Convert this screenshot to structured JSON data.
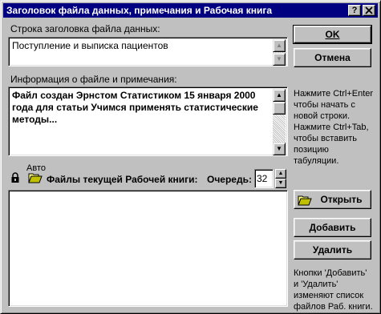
{
  "window": {
    "title": "Заголовок файла данных, примечания и Рабочая книга",
    "help_button": "?",
    "close_button": "×"
  },
  "header": {
    "label": "Строка заголовка файла данных:",
    "value": "Поступление и выписка пациентов"
  },
  "info": {
    "label": "Информация о файле и примечания:",
    "value": "Файл создан Эрнстом Статистиком 15 января 2000 года для статьи Учимся применять статистические методы..."
  },
  "workbook": {
    "auto_label": "Авто",
    "files_label": "Файлы текущей Рабочей книги:",
    "queue_label": "Очередь:",
    "queue_value": "32",
    "files": []
  },
  "buttons": {
    "ok": "OK",
    "cancel": "Отмена",
    "open": "Открыть",
    "add": "Добавить",
    "delete": "Удалить"
  },
  "help": {
    "notes_tip": "Нажмите Ctrl+Enter\nчтобы начать с\nновой строки.\nНажмите Ctrl+Tab,\nчтобы вставить\nпозицию\nтабуляции.",
    "workbook_tip": "Кнопки 'Добавить'\nи 'Удалить'\nизменяют список\nфайлов Раб. книги."
  },
  "icons": {
    "lock": "lock-icon",
    "folder": "folder-open-icon"
  }
}
